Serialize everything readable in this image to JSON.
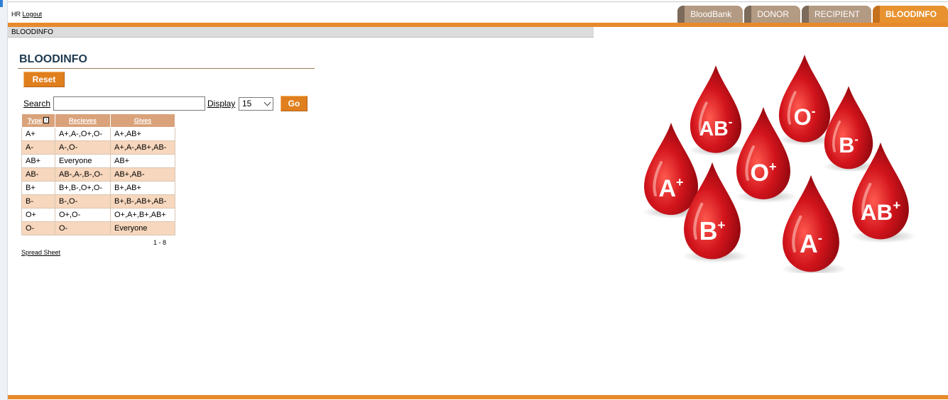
{
  "header": {
    "user": "HR",
    "logout_label": "Logout"
  },
  "tabs": [
    {
      "label": "BloodBank",
      "active": false
    },
    {
      "label": "DONOR",
      "active": false
    },
    {
      "label": "RECIPIENT",
      "active": false
    },
    {
      "label": "BLOODINFO",
      "active": true
    }
  ],
  "breadcrumb": "BLOODINFO",
  "page_title": "BLOODINFO",
  "buttons": {
    "reset": "Reset",
    "go": "Go"
  },
  "search": {
    "label": "Search",
    "value": ""
  },
  "display": {
    "label": "Display",
    "value": "15"
  },
  "table": {
    "headers": [
      "Type",
      "Recieves",
      "Gives"
    ],
    "rows": [
      [
        "A+",
        "A+,A-,O+,O-",
        "A+,AB+"
      ],
      [
        "A-",
        "A-,O-",
        "A+,A-,AB+,AB-"
      ],
      [
        "AB+",
        "Everyone",
        "AB+"
      ],
      [
        "AB-",
        "AB-,A-,B-,O-",
        "AB+,AB-"
      ],
      [
        "B+",
        "B+,B-,O+,O-",
        "B+,AB+"
      ],
      [
        "B-",
        "B-,O-",
        "B+,B-,AB+,AB-"
      ],
      [
        "O+",
        "O+,O-",
        "O+,A+,B+,AB+"
      ],
      [
        "O-",
        "O-",
        "Everyone"
      ]
    ]
  },
  "pager": "1 - 8",
  "spreadsheet_label": "Spread Sheet",
  "image": {
    "drops": [
      {
        "type": "A",
        "sign": "+"
      },
      {
        "type": "AB",
        "sign": "-"
      },
      {
        "type": "O",
        "sign": "+"
      },
      {
        "type": "O",
        "sign": "-"
      },
      {
        "type": "B",
        "sign": "-"
      },
      {
        "type": "B",
        "sign": "+"
      },
      {
        "type": "A",
        "sign": "-"
      },
      {
        "type": "AB",
        "sign": "+"
      }
    ]
  },
  "colors": {
    "accent": "#e88a2c",
    "tab_inactive": "#b39a83",
    "table_header": "#d9a27a",
    "table_alt_row": "#f7d7bd",
    "drop_red": "#c0141b"
  }
}
